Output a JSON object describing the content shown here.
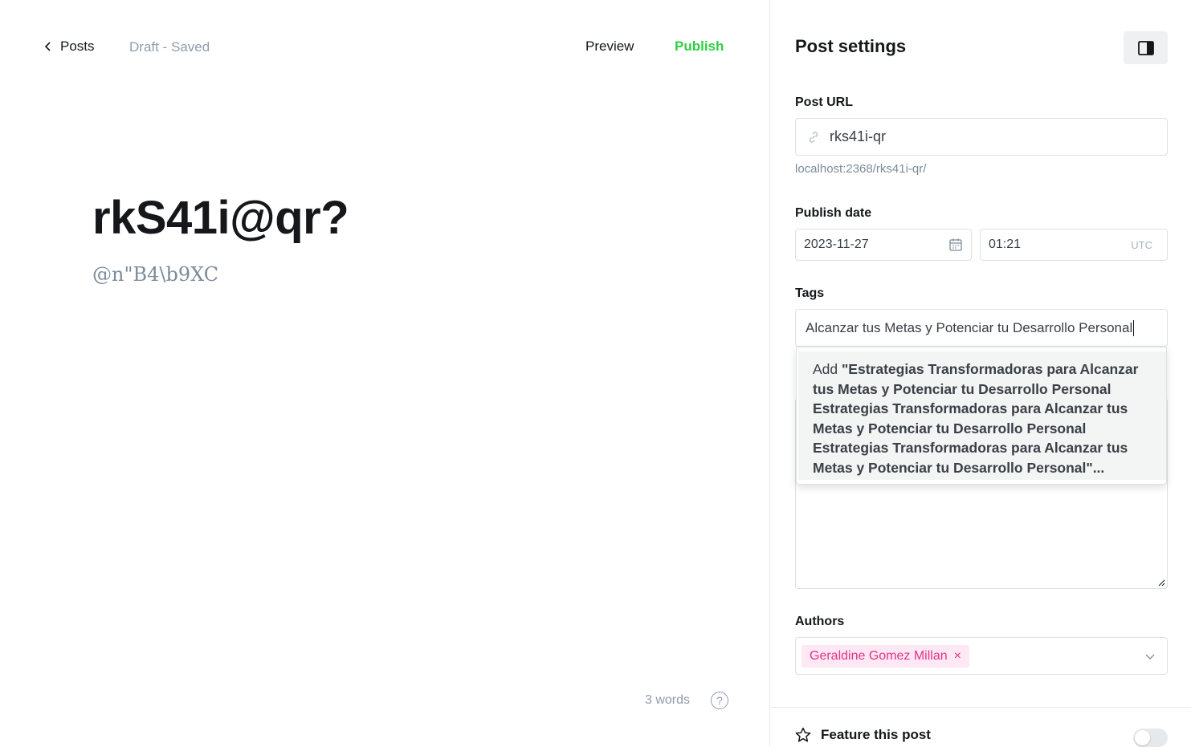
{
  "editor": {
    "back_label": "Posts",
    "status": "Draft - Saved",
    "preview_label": "Preview",
    "publish_label": "Publish",
    "title": "rkS41i@qr?",
    "excerpt": "@n\"B4\\b9XC",
    "word_count": "3 words",
    "help_icon": "?"
  },
  "settings": {
    "title": "Post settings",
    "post_url": {
      "label": "Post URL",
      "value": "rks41i-qr",
      "hint": "localhost:2368/rks41i-qr/"
    },
    "publish_date": {
      "label": "Publish date",
      "date": "2023-11-27",
      "time": "01:21",
      "timezone": "UTC"
    },
    "tags": {
      "label": "Tags",
      "input_value": "Alcanzar tus Metas y Potenciar tu Desarrollo Personal",
      "dropdown_prefix": "Add ",
      "dropdown_value": "\"Estrategias Transformadoras para Alcanzar tus Metas y Potenciar tu Desarrollo Personal Estrategias Transformadoras para Alcanzar tus Metas y Potenciar tu Desarrollo Personal Estrategias Transformadoras para Alcanzar tus Metas y Potenciar tu Desarrollo Personal\"..."
    },
    "authors": {
      "label": "Authors",
      "selected": "Geraldine Gomez Millan",
      "remove_icon": "×"
    },
    "feature": {
      "label": "Feature this post",
      "enabled": false
    }
  },
  "colors": {
    "publish": "#30cf43",
    "author_token_bg": "#fde8f3",
    "author_token_text": "#e0338a"
  }
}
